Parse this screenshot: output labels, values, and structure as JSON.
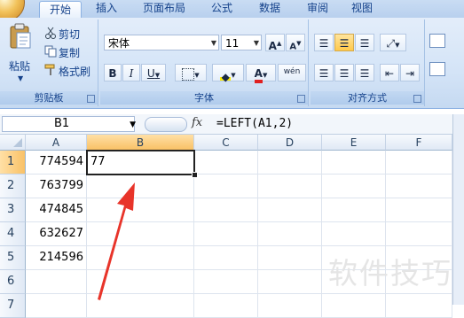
{
  "tabs": [
    {
      "label": "开始",
      "active": true
    },
    {
      "label": "插入",
      "active": false
    },
    {
      "label": "页面布局",
      "active": false
    },
    {
      "label": "公式",
      "active": false
    },
    {
      "label": "数据",
      "active": false
    },
    {
      "label": "审阅",
      "active": false
    },
    {
      "label": "视图",
      "active": false
    }
  ],
  "clipboard": {
    "paste": "粘贴",
    "cut": "剪切",
    "copy": "复制",
    "format_painter": "格式刷",
    "group": "剪贴板"
  },
  "font": {
    "name": "宋体",
    "size": "11",
    "bold": "B",
    "italic": "I",
    "underline": "U",
    "color_glyph": "A",
    "phonetic": "wén",
    "group": "字体"
  },
  "alignment": {
    "group": "对齐方式"
  },
  "formula_bar": {
    "name_box": "B1",
    "fx": "fx",
    "formula": "=LEFT(A1,2)"
  },
  "columns": [
    "A",
    "B",
    "C",
    "D",
    "E",
    "F"
  ],
  "rows": [
    "1",
    "2",
    "3",
    "4",
    "5",
    "6",
    "7"
  ],
  "cells": {
    "A": [
      "774594",
      "763799",
      "474845",
      "632627",
      "214596",
      "",
      ""
    ],
    "B": [
      "77",
      "",
      "",
      "",
      "",
      "",
      ""
    ]
  },
  "selected_cell": "B1",
  "colors": {
    "accent": "#15428b",
    "arrow": "#e8342a",
    "selection": "#f9c166"
  },
  "watermark": "软件技巧"
}
